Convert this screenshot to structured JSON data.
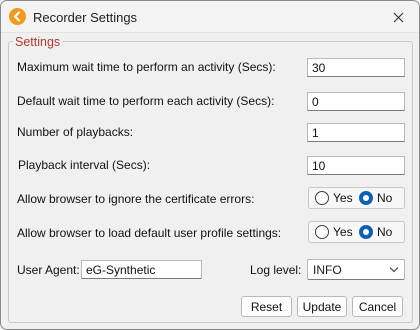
{
  "window": {
    "title": "Recorder Settings",
    "app_icon": "recorder-logo-icon",
    "close_icon": "close-icon"
  },
  "settings": {
    "group_title": "Settings",
    "max_wait": {
      "label": "Maximum wait time to perform an activity (Secs):",
      "value": "30"
    },
    "default_wait": {
      "label": "Default wait time to perform each activity (Secs):",
      "value": "0"
    },
    "playbacks": {
      "label": "Number of playbacks:",
      "value": "1"
    },
    "interval": {
      "label": "Playback interval (Secs):",
      "value": "10"
    },
    "ignore_cert": {
      "label": "Allow browser to ignore the certificate errors:",
      "yes": "Yes",
      "no": "No",
      "selected": "No"
    },
    "load_profile": {
      "label": "Allow browser to load default user profile settings:",
      "yes": "Yes",
      "no": "No",
      "selected": "No"
    },
    "user_agent": {
      "label": "User Agent:",
      "value": "eG-Synthetic"
    },
    "log_level": {
      "label": "Log level:",
      "value": "INFO"
    }
  },
  "buttons": {
    "reset": "Reset",
    "update": "Update",
    "cancel": "Cancel"
  },
  "colors": {
    "accent": "#0f5fb8",
    "group_title": "#b53a2e",
    "app_icon": "#f39a1c"
  }
}
